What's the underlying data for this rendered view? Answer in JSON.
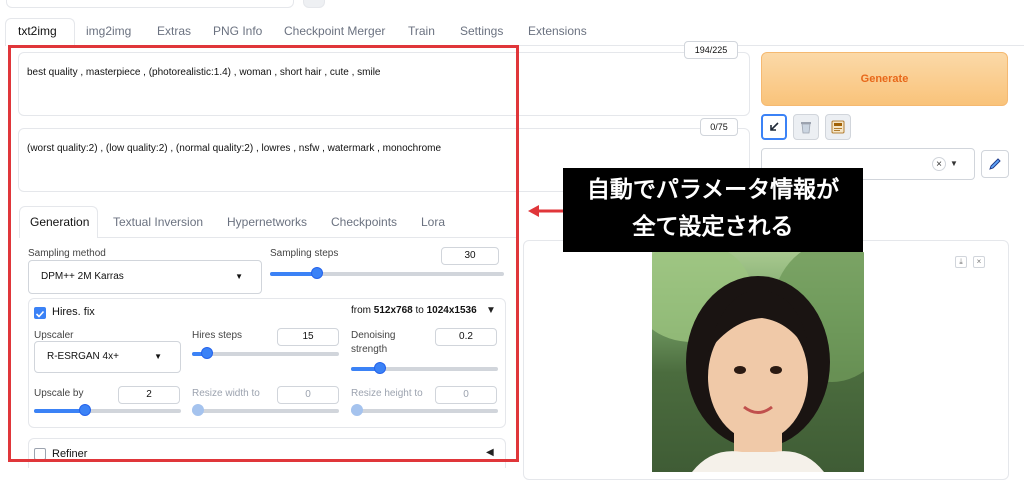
{
  "tabs": [
    "txt2img",
    "img2img",
    "Extras",
    "PNG Info",
    "Checkpoint Merger",
    "Train",
    "Settings",
    "Extensions"
  ],
  "prompt": {
    "text": "best quality , masterpiece , (photorealistic:1.4) , woman , short hair , cute , smile",
    "counter": "194/225"
  },
  "negative_prompt": {
    "text": "(worst quality:2) , (low quality:2) , (normal quality:2) , lowres , nsfw , watermark , monochrome",
    "counter": "0/75"
  },
  "generate_label": "Generate",
  "style_clear": "×",
  "subtabs": [
    "Generation",
    "Textual Inversion",
    "Hypernetworks",
    "Checkpoints",
    "Lora"
  ],
  "sampling": {
    "method_label": "Sampling method",
    "method_value": "DPM++ 2M Karras",
    "steps_label": "Sampling steps",
    "steps_value": "30",
    "steps_fraction": 0.2
  },
  "hires": {
    "label": "Hires. fix",
    "checked": true,
    "from_prefix": "from",
    "from_size": "512x768",
    "to_prefix": "to",
    "to_size": "1024x1536",
    "upscaler_label": "Upscaler",
    "upscaler_value": "R-ESRGAN 4x+",
    "steps_label": "Hires steps",
    "steps_value": "15",
    "steps_fraction": 0.1,
    "denoise_label_1": "Denoising",
    "denoise_label_2": "strength",
    "denoise_value": "0.2",
    "denoise_fraction": 0.2,
    "upscale_label": "Upscale by",
    "upscale_value": "2",
    "upscale_fraction": 0.35,
    "resize_w_label": "Resize width to",
    "resize_w_value": "0",
    "resize_h_label": "Resize height to",
    "resize_h_value": "0"
  },
  "refiner_label": "Refiner",
  "callout": {
    "line1": "自動でパラメータ情報が",
    "line2": "全て設定される"
  },
  "colors": {
    "accent": "#3b82f6",
    "highlight": "#e0363a",
    "generate_text": "#e8681a"
  }
}
